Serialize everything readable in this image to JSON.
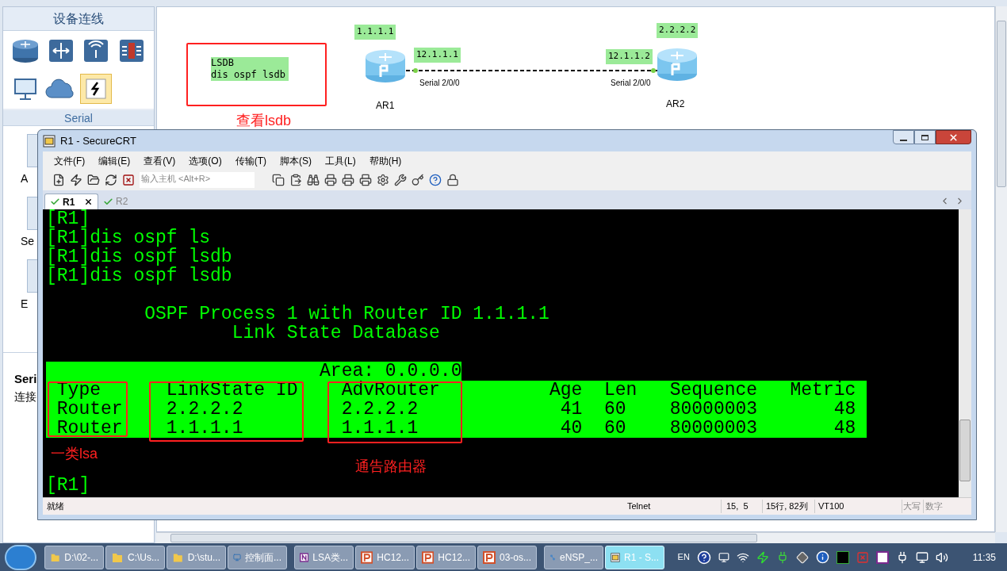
{
  "device_panel": {
    "title": "设备连线",
    "devices": [
      {
        "kind": "router",
        "selected": false
      },
      {
        "kind": "switch",
        "selected": false
      },
      {
        "kind": "wireless",
        "selected": false
      },
      {
        "kind": "firewall",
        "selected": false
      },
      {
        "kind": "pc",
        "selected": false
      },
      {
        "kind": "cloud",
        "selected": false
      },
      {
        "kind": "cable",
        "selected": true
      }
    ],
    "section": "Serial",
    "items": [
      "A",
      "Se",
      "E"
    ],
    "info_title": "Seri",
    "info_text": "连接"
  },
  "canvas": {
    "note": [
      "LSDB",
      "dis ospf lsdb"
    ],
    "note_caption": "查看lsdb",
    "routers": [
      {
        "name": "AR1",
        "router_id": "1.1.1.1",
        "ip": "12.1.1.1",
        "interface": "Serial 2/0/0"
      },
      {
        "name": "AR2",
        "router_id": "2.2.2.2",
        "ip": "12.1.1.2",
        "interface": "Serial 2/0/0"
      }
    ]
  },
  "terminal_window": {
    "title": "R1 - SecureCRT",
    "menu": [
      "文件(F)",
      "编辑(E)",
      "查看(V)",
      "选项(O)",
      "传输(T)",
      "脚本(S)",
      "工具(L)",
      "帮助(H)"
    ],
    "host_placeholder": "输入主机 <Alt+R>",
    "tabs": [
      {
        "label": "R1",
        "selected": true
      },
      {
        "label": "R2",
        "selected": false
      }
    ],
    "lines": [
      "[R1]",
      "[R1]dis ospf ls",
      "[R1]dis ospf lsdb",
      "[R1]dis ospf lsdb"
    ],
    "ospf_title": "OSPF Process 1 with Router ID 1.1.1.1",
    "db_title": "Link State Database",
    "area": "Area: 0.0.0.0",
    "lsdb": {
      "columns": [
        "Type",
        "LinkState ID",
        "AdvRouter",
        "Age",
        "Len",
        "Sequence",
        "Metric"
      ],
      "rows": [
        [
          "Router",
          "2.2.2.2",
          "2.2.2.2",
          "41",
          "60",
          "80000003",
          "48"
        ],
        [
          "Router",
          "1.1.1.1",
          "1.1.1.1",
          "40",
          "60",
          "80000003",
          "48"
        ]
      ]
    },
    "prompt": "[R1]",
    "annotations": [
      "一类lsa",
      "通告路由器"
    ],
    "status": {
      "state": "就绪",
      "protocol": "Telnet",
      "cursor": "15,  5",
      "position": "15行, 82列",
      "emulation": "VT100",
      "caps": "大写",
      "num": "数字"
    }
  },
  "taskbar": {
    "items": [
      {
        "label": "D:\\02-...",
        "kind": "folder",
        "selected": false
      },
      {
        "label": "C:\\Us...",
        "kind": "folder",
        "selected": false
      },
      {
        "label": "D:\\stu...",
        "kind": "folder",
        "selected": false
      },
      {
        "label": "控制面...",
        "kind": "control",
        "selected": false
      },
      {
        "label": "LSA类...",
        "kind": "onenote",
        "selected": false
      },
      {
        "label": "HC12...",
        "kind": "ppt",
        "selected": false
      },
      {
        "label": "HC12...",
        "kind": "ppt",
        "selected": false
      },
      {
        "label": "03-os...",
        "kind": "ppt",
        "selected": false
      },
      {
        "label": "eNSP_...",
        "kind": "ensp",
        "selected": false
      },
      {
        "label": "R1 - S...",
        "kind": "terminal",
        "selected": true
      }
    ],
    "language": "EN",
    "clock": "11:35"
  }
}
